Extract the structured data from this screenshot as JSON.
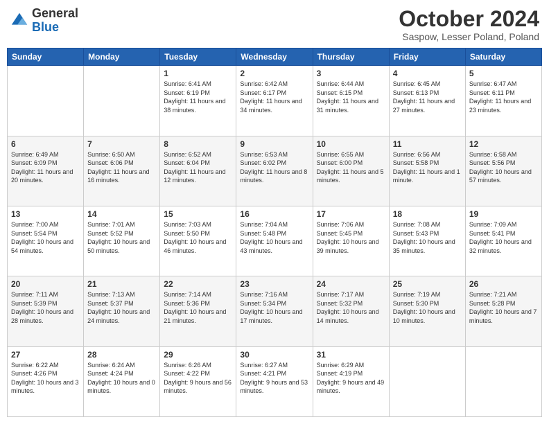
{
  "header": {
    "logo_general": "General",
    "logo_blue": "Blue",
    "month_title": "October 2024",
    "location": "Saspow, Lesser Poland, Poland"
  },
  "weekdays": [
    "Sunday",
    "Monday",
    "Tuesday",
    "Wednesday",
    "Thursday",
    "Friday",
    "Saturday"
  ],
  "weeks": [
    [
      {
        "day": "",
        "sunrise": "",
        "sunset": "",
        "daylight": ""
      },
      {
        "day": "",
        "sunrise": "",
        "sunset": "",
        "daylight": ""
      },
      {
        "day": "1",
        "sunrise": "Sunrise: 6:41 AM",
        "sunset": "Sunset: 6:19 PM",
        "daylight": "Daylight: 11 hours and 38 minutes."
      },
      {
        "day": "2",
        "sunrise": "Sunrise: 6:42 AM",
        "sunset": "Sunset: 6:17 PM",
        "daylight": "Daylight: 11 hours and 34 minutes."
      },
      {
        "day": "3",
        "sunrise": "Sunrise: 6:44 AM",
        "sunset": "Sunset: 6:15 PM",
        "daylight": "Daylight: 11 hours and 31 minutes."
      },
      {
        "day": "4",
        "sunrise": "Sunrise: 6:45 AM",
        "sunset": "Sunset: 6:13 PM",
        "daylight": "Daylight: 11 hours and 27 minutes."
      },
      {
        "day": "5",
        "sunrise": "Sunrise: 6:47 AM",
        "sunset": "Sunset: 6:11 PM",
        "daylight": "Daylight: 11 hours and 23 minutes."
      }
    ],
    [
      {
        "day": "6",
        "sunrise": "Sunrise: 6:49 AM",
        "sunset": "Sunset: 6:09 PM",
        "daylight": "Daylight: 11 hours and 20 minutes."
      },
      {
        "day": "7",
        "sunrise": "Sunrise: 6:50 AM",
        "sunset": "Sunset: 6:06 PM",
        "daylight": "Daylight: 11 hours and 16 minutes."
      },
      {
        "day": "8",
        "sunrise": "Sunrise: 6:52 AM",
        "sunset": "Sunset: 6:04 PM",
        "daylight": "Daylight: 11 hours and 12 minutes."
      },
      {
        "day": "9",
        "sunrise": "Sunrise: 6:53 AM",
        "sunset": "Sunset: 6:02 PM",
        "daylight": "Daylight: 11 hours and 8 minutes."
      },
      {
        "day": "10",
        "sunrise": "Sunrise: 6:55 AM",
        "sunset": "Sunset: 6:00 PM",
        "daylight": "Daylight: 11 hours and 5 minutes."
      },
      {
        "day": "11",
        "sunrise": "Sunrise: 6:56 AM",
        "sunset": "Sunset: 5:58 PM",
        "daylight": "Daylight: 11 hours and 1 minute."
      },
      {
        "day": "12",
        "sunrise": "Sunrise: 6:58 AM",
        "sunset": "Sunset: 5:56 PM",
        "daylight": "Daylight: 10 hours and 57 minutes."
      }
    ],
    [
      {
        "day": "13",
        "sunrise": "Sunrise: 7:00 AM",
        "sunset": "Sunset: 5:54 PM",
        "daylight": "Daylight: 10 hours and 54 minutes."
      },
      {
        "day": "14",
        "sunrise": "Sunrise: 7:01 AM",
        "sunset": "Sunset: 5:52 PM",
        "daylight": "Daylight: 10 hours and 50 minutes."
      },
      {
        "day": "15",
        "sunrise": "Sunrise: 7:03 AM",
        "sunset": "Sunset: 5:50 PM",
        "daylight": "Daylight: 10 hours and 46 minutes."
      },
      {
        "day": "16",
        "sunrise": "Sunrise: 7:04 AM",
        "sunset": "Sunset: 5:48 PM",
        "daylight": "Daylight: 10 hours and 43 minutes."
      },
      {
        "day": "17",
        "sunrise": "Sunrise: 7:06 AM",
        "sunset": "Sunset: 5:45 PM",
        "daylight": "Daylight: 10 hours and 39 minutes."
      },
      {
        "day": "18",
        "sunrise": "Sunrise: 7:08 AM",
        "sunset": "Sunset: 5:43 PM",
        "daylight": "Daylight: 10 hours and 35 minutes."
      },
      {
        "day": "19",
        "sunrise": "Sunrise: 7:09 AM",
        "sunset": "Sunset: 5:41 PM",
        "daylight": "Daylight: 10 hours and 32 minutes."
      }
    ],
    [
      {
        "day": "20",
        "sunrise": "Sunrise: 7:11 AM",
        "sunset": "Sunset: 5:39 PM",
        "daylight": "Daylight: 10 hours and 28 minutes."
      },
      {
        "day": "21",
        "sunrise": "Sunrise: 7:13 AM",
        "sunset": "Sunset: 5:37 PM",
        "daylight": "Daylight: 10 hours and 24 minutes."
      },
      {
        "day": "22",
        "sunrise": "Sunrise: 7:14 AM",
        "sunset": "Sunset: 5:36 PM",
        "daylight": "Daylight: 10 hours and 21 minutes."
      },
      {
        "day": "23",
        "sunrise": "Sunrise: 7:16 AM",
        "sunset": "Sunset: 5:34 PM",
        "daylight": "Daylight: 10 hours and 17 minutes."
      },
      {
        "day": "24",
        "sunrise": "Sunrise: 7:17 AM",
        "sunset": "Sunset: 5:32 PM",
        "daylight": "Daylight: 10 hours and 14 minutes."
      },
      {
        "day": "25",
        "sunrise": "Sunrise: 7:19 AM",
        "sunset": "Sunset: 5:30 PM",
        "daylight": "Daylight: 10 hours and 10 minutes."
      },
      {
        "day": "26",
        "sunrise": "Sunrise: 7:21 AM",
        "sunset": "Sunset: 5:28 PM",
        "daylight": "Daylight: 10 hours and 7 minutes."
      }
    ],
    [
      {
        "day": "27",
        "sunrise": "Sunrise: 6:22 AM",
        "sunset": "Sunset: 4:26 PM",
        "daylight": "Daylight: 10 hours and 3 minutes."
      },
      {
        "day": "28",
        "sunrise": "Sunrise: 6:24 AM",
        "sunset": "Sunset: 4:24 PM",
        "daylight": "Daylight: 10 hours and 0 minutes."
      },
      {
        "day": "29",
        "sunrise": "Sunrise: 6:26 AM",
        "sunset": "Sunset: 4:22 PM",
        "daylight": "Daylight: 9 hours and 56 minutes."
      },
      {
        "day": "30",
        "sunrise": "Sunrise: 6:27 AM",
        "sunset": "Sunset: 4:21 PM",
        "daylight": "Daylight: 9 hours and 53 minutes."
      },
      {
        "day": "31",
        "sunrise": "Sunrise: 6:29 AM",
        "sunset": "Sunset: 4:19 PM",
        "daylight": "Daylight: 9 hours and 49 minutes."
      },
      {
        "day": "",
        "sunrise": "",
        "sunset": "",
        "daylight": ""
      },
      {
        "day": "",
        "sunrise": "",
        "sunset": "",
        "daylight": ""
      }
    ]
  ]
}
